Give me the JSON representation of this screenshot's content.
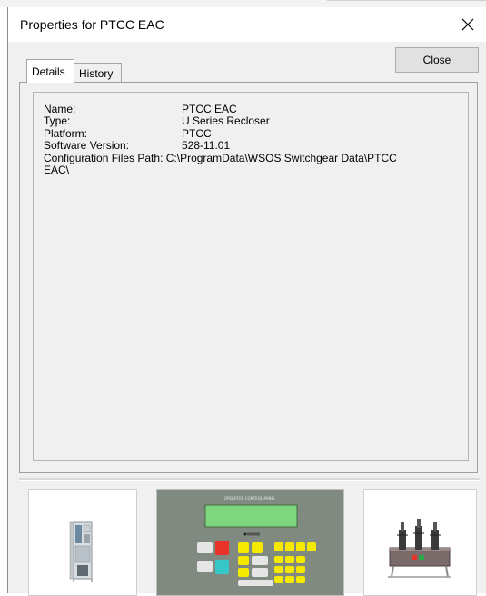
{
  "window": {
    "title": "Properties for PTCC EAC",
    "close_icon": "close-icon"
  },
  "tabs": [
    {
      "label": "Details",
      "selected": true
    },
    {
      "label": "History",
      "selected": false
    }
  ],
  "buttons": {
    "close_label": "Close"
  },
  "details": [
    {
      "label": "Name:",
      "value": "PTCC EAC"
    },
    {
      "label": "Type:",
      "value": "U Series Recloser"
    },
    {
      "label": "Platform:",
      "value": "PTCC"
    },
    {
      "label": "Software Version:",
      "value": "528-11.01"
    }
  ],
  "config_path": {
    "label": "Configuration Files Path:",
    "value_line1": "C:\\ProgramData\\WSOS Switchgear Data\\PTCC",
    "value_line2": "EAC\\"
  },
  "thumbnails": [
    {
      "name": "control-cabinet-image"
    },
    {
      "name": "operator-panel-image",
      "caption": "OPERATOR CONTROL PANEL"
    },
    {
      "name": "recloser-image"
    }
  ],
  "colors": {
    "dialog_bg": "#f0f0f0",
    "panel_green": "#808a80",
    "lcd_green": "#7ed67e",
    "key_yellow": "#f5e900",
    "key_red": "#e8332a",
    "key_cyan": "#36c8c8"
  }
}
